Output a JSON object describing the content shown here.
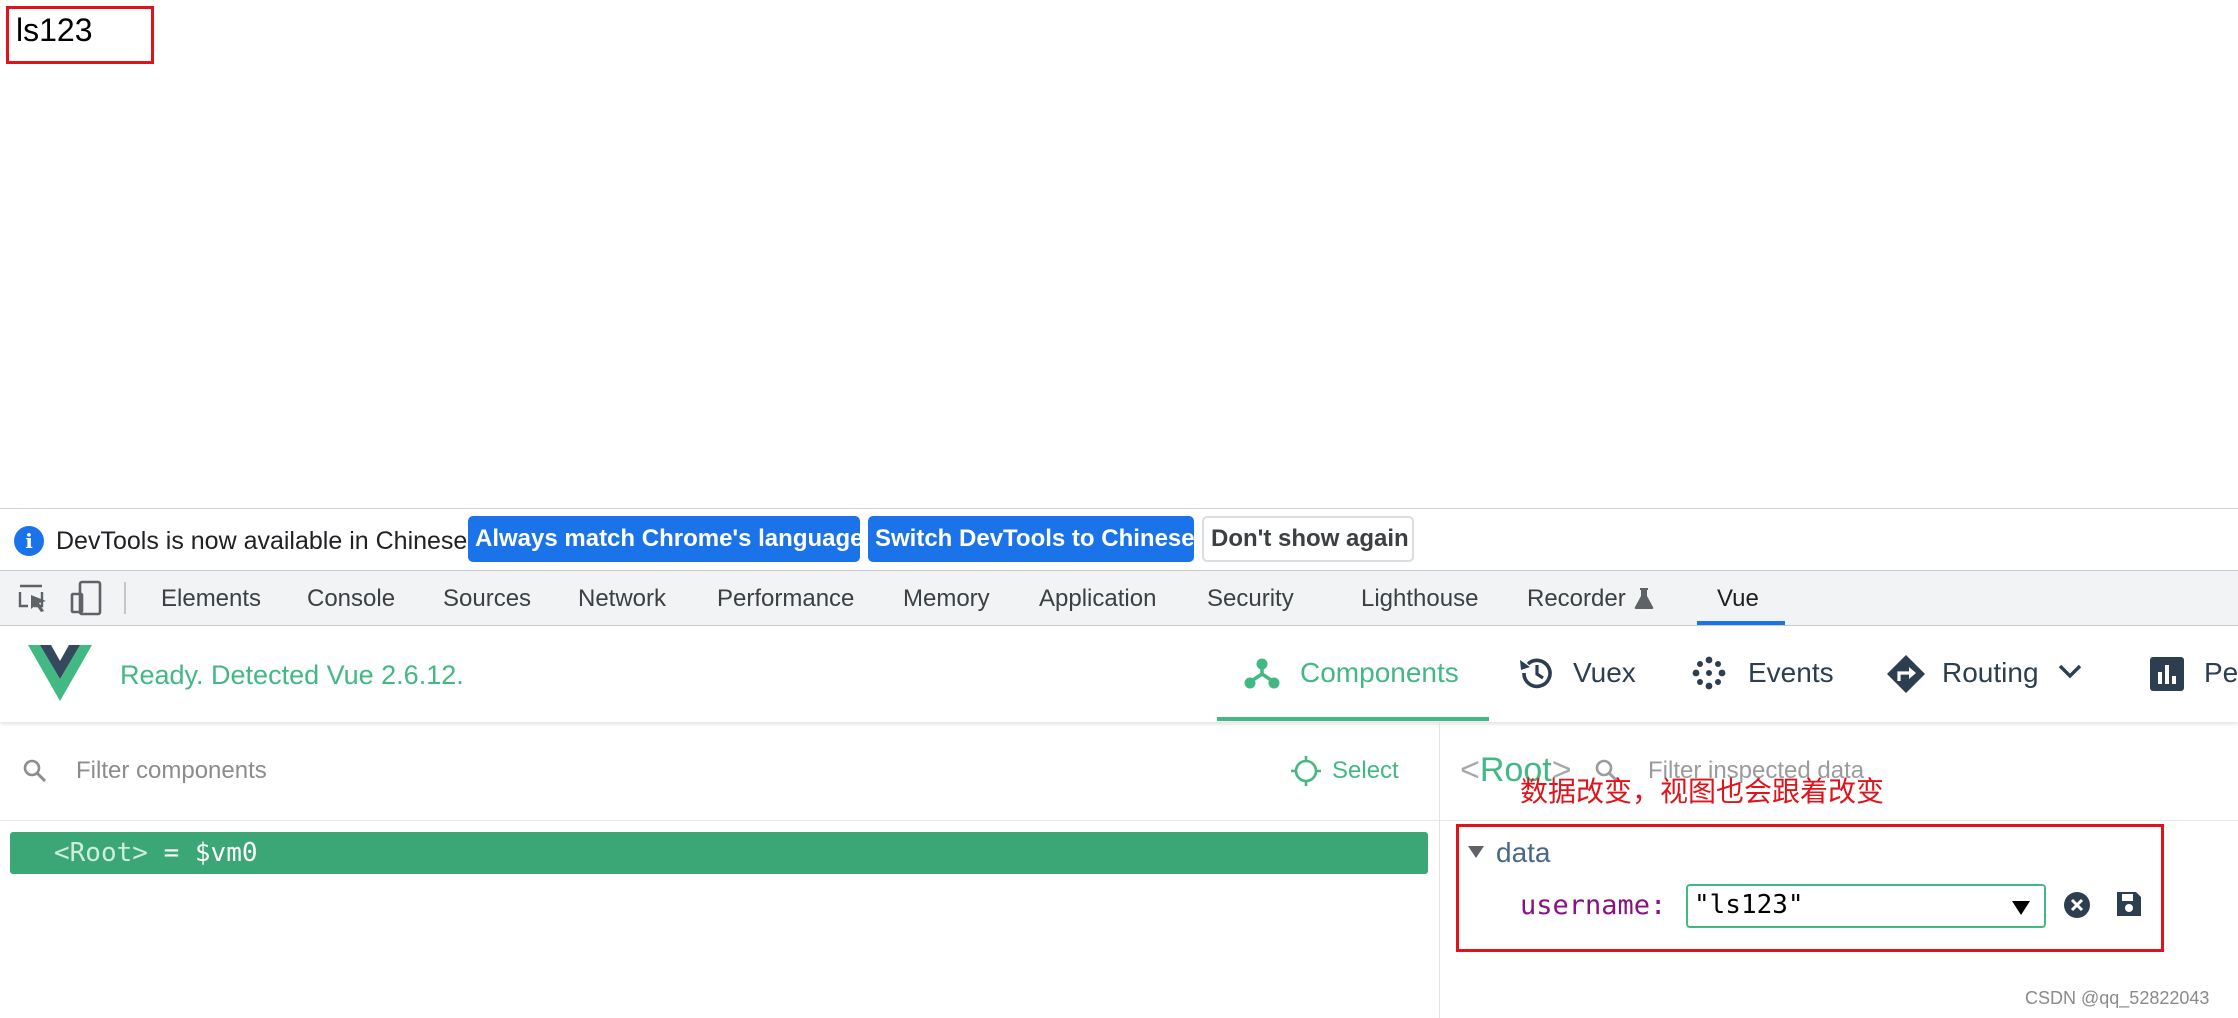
{
  "page": {
    "display_text": "ls123"
  },
  "infobar": {
    "message": "DevTools is now available in Chinese!",
    "buttons": [
      "Always match Chrome's language",
      "Switch DevTools to Chinese",
      "Don't show again"
    ]
  },
  "devtools_tabs": [
    "Elements",
    "Console",
    "Sources",
    "Network",
    "Performance",
    "Memory",
    "Application",
    "Security",
    "Lighthouse",
    "Recorder",
    "Vue"
  ],
  "devtools_active_tab": "Vue",
  "vue": {
    "status": "Ready. Detected Vue 2.6.12.",
    "nav": [
      "Components",
      "Vuex",
      "Events",
      "Routing",
      "Pe"
    ],
    "active_nav": "Components"
  },
  "components_panel": {
    "filter_placeholder": "Filter components",
    "select_label": "Select",
    "root_tag": "<Root>",
    "root_suffix": " = $vm0"
  },
  "inspector": {
    "root_name": "Root",
    "root_open": "<",
    "root_close": ">",
    "filter_placeholder": "Filter inspected data",
    "annotation": "数据改变，视图也会跟着改变",
    "section": "data",
    "property_key": "username:",
    "property_value": "\"ls123\""
  },
  "colors": {
    "vue_green": "#42b883",
    "devtools_blue": "#1a73e8",
    "annotation_red": "#e0131b"
  },
  "watermark": "CSDN @qq_52822043"
}
